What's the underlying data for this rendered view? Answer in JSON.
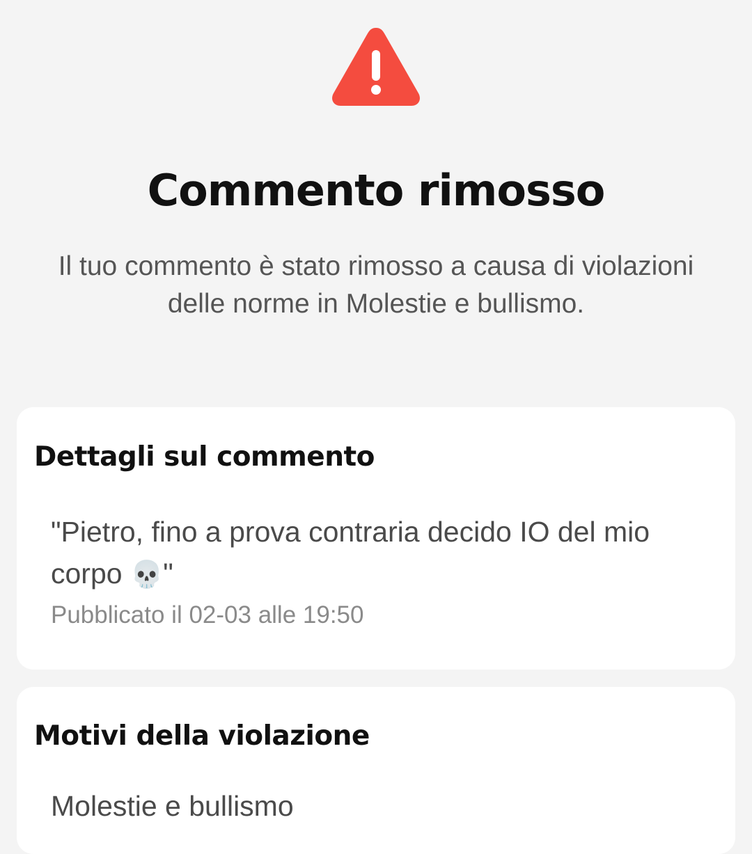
{
  "header": {
    "icon": "warning-triangle-icon",
    "title": "Commento rimosso",
    "subtitle": "Il tuo commento è stato rimosso a causa di violazioni delle norme in Molestie e bullismo.",
    "accent_color": "#f44c3f"
  },
  "comment_details": {
    "heading": "Dettagli sul commento",
    "text": "\"Pietro, fino a prova contraria decido IO del mio corpo ",
    "emoji": "💀",
    "emoji_icon": "skull-icon",
    "text_end": "\"",
    "published": "Pubblicato il 02-03 alle 19:50"
  },
  "violation": {
    "heading": "Motivi della violazione",
    "reason": "Molestie e bullismo"
  }
}
